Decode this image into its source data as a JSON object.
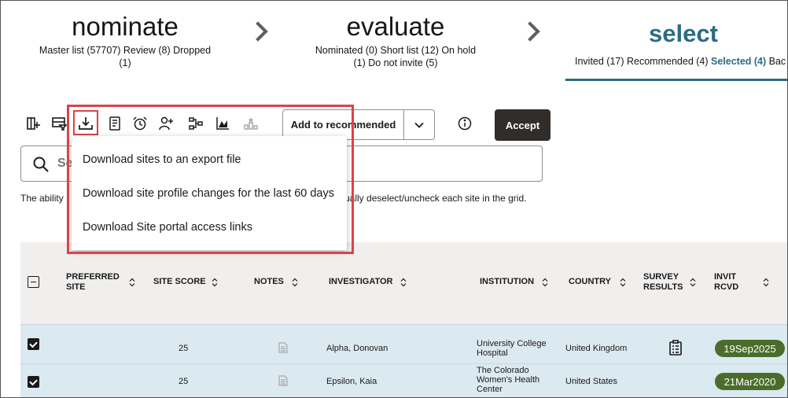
{
  "stages": {
    "nominate": {
      "title": "nominate",
      "line1": "Master list (57707)  Review (8)  Dropped",
      "line2": "(1)"
    },
    "evaluate": {
      "title": "evaluate",
      "line1": "Nominated (0)  Short list (12)  On hold",
      "line2": "(1)  Do not invite (5)"
    },
    "select": {
      "title": "select",
      "pre": "Invited (17)  Recommended (4) ",
      "active": "Selected (4)",
      "post": " Bac"
    }
  },
  "toolbar": {
    "add_to_recommended": "Add to recommended",
    "accept": "Accept"
  },
  "search": {
    "placeholder": "Se"
  },
  "note": {
    "head": "The ability",
    "tail": "ually deselect/uncheck each site in the grid."
  },
  "dropdown": {
    "items": [
      "Download sites to an export file",
      "Download site profile changes for the last 60 days",
      "Download Site portal access links"
    ]
  },
  "grid": {
    "columns": [
      {
        "l1": "PREFERRED",
        "l2": "SITE"
      },
      {
        "l1": "SITE SCORE",
        "l2": ""
      },
      {
        "l1": "NOTES",
        "l2": ""
      },
      {
        "l1": "INVESTIGATOR",
        "l2": ""
      },
      {
        "l1": "INSTITUTION",
        "l2": ""
      },
      {
        "l1": "COUNTRY",
        "l2": ""
      },
      {
        "l1": "SURVEY",
        "l2": "RESULTS"
      },
      {
        "l1": "INVIT",
        "l2": "RCVD"
      }
    ],
    "rows": [
      {
        "score": "25",
        "investigator": "Alpha, Donovan",
        "institution": [
          "University College",
          "Hospital",
          ""
        ],
        "country": "United Kingdom",
        "invit": "19Sep2025"
      },
      {
        "score": "25",
        "investigator": "Epsilon, Kaia",
        "institution": [
          "The Colorado",
          "Women's Health",
          "Center"
        ],
        "country": "United States",
        "invit": "21Mar2020"
      }
    ]
  },
  "colors": {
    "accent": "#2b6c84",
    "highlight": "#d9434a",
    "badge": "#4a6d2b",
    "row_selected": "#dbe9f0"
  }
}
